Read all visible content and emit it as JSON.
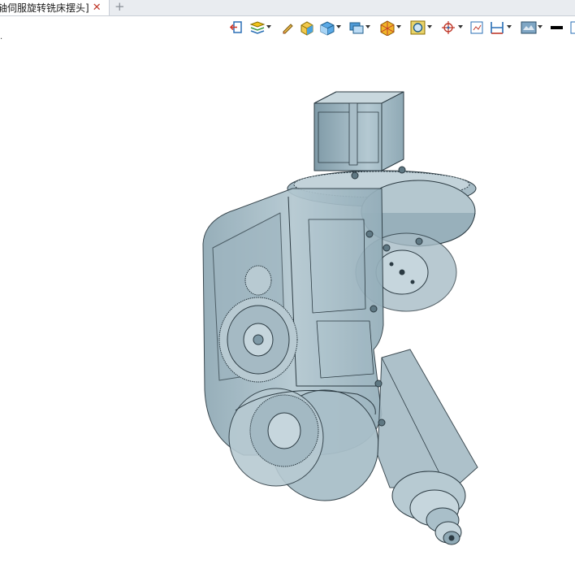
{
  "tab": {
    "title": "轴伺服旋转铣床摆头]",
    "close_glyph": "✕",
    "add_glyph": "+"
  },
  "status_text": ".",
  "toolbar": {
    "items": [
      {
        "icon": "exit-icon",
        "dropdown": false
      },
      {
        "icon": "layers-icon",
        "dropdown": true
      },
      {
        "icon": "pencil-icon",
        "dropdown": false
      },
      {
        "icon": "solid-cube-icon",
        "dropdown": false
      },
      {
        "icon": "render-cube-icon",
        "dropdown": true
      },
      {
        "icon": "view-box-icon",
        "dropdown": true
      },
      {
        "icon": "hexagon-view-icon",
        "dropdown": true
      },
      {
        "icon": "zoom-fit-icon",
        "dropdown": true
      },
      {
        "icon": "target-icon",
        "dropdown": true
      },
      {
        "icon": "sketch-grid-icon",
        "dropdown": false
      },
      {
        "icon": "dimension-icon",
        "dropdown": true
      },
      {
        "icon": "display-settings-icon",
        "dropdown": true
      },
      {
        "icon": "line-weight-icon",
        "dropdown": false
      }
    ]
  },
  "colors": {
    "model_fill": "#9db5c0",
    "model_light": "#c6d6dd",
    "model_dark": "#5f7883",
    "edge": "#2b3a42"
  }
}
